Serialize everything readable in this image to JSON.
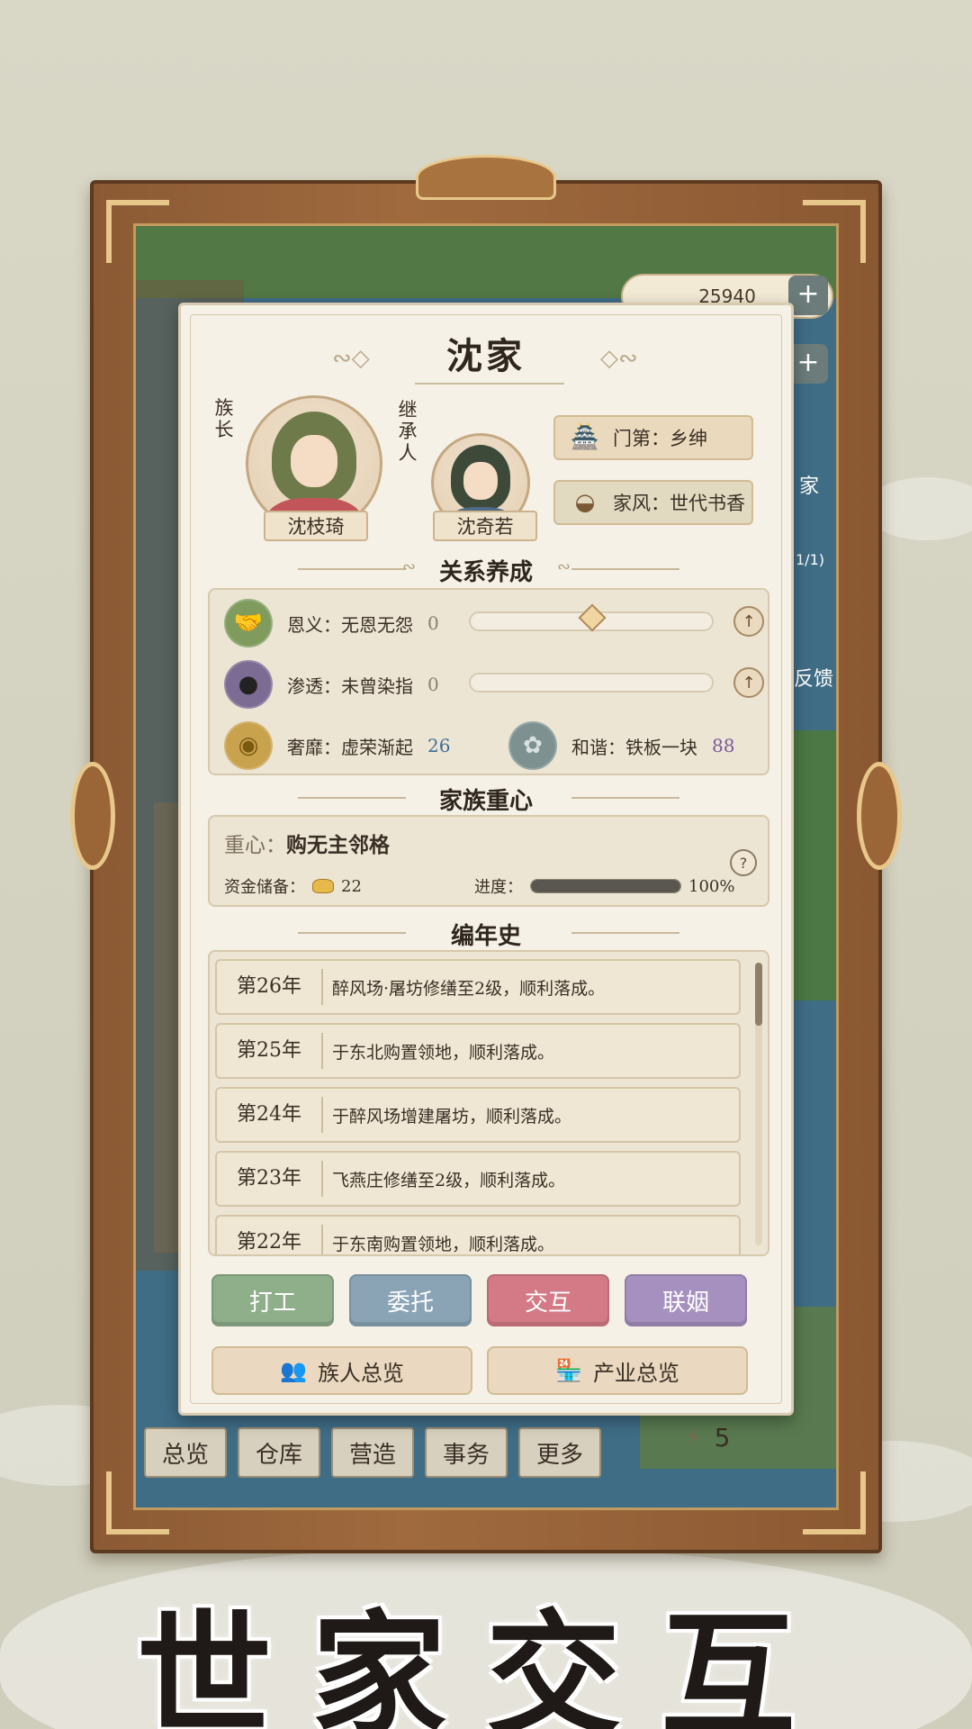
{
  "background_hud": {
    "coins": "25940",
    "plus": "+",
    "side_labels": [
      "家",
      "1/1)",
      "反馈"
    ],
    "bottom_tabs": [
      "总览",
      "仓库",
      "营造",
      "事务",
      "更多"
    ],
    "energy": "5"
  },
  "panel": {
    "clan_name": "沈家",
    "leader": {
      "role": "族长",
      "name": "沈枝琦"
    },
    "heir": {
      "role": "继承人",
      "name": "沈奇若"
    },
    "tags": [
      {
        "icon": "pavilion-icon",
        "text": "门第：乡绅"
      },
      {
        "icon": "fan-icon",
        "text": "家风：世代书香"
      }
    ],
    "relations": {
      "title": "关系养成",
      "rows": [
        {
          "icon": "handshake-icon",
          "label": "恩义：无恩无怨",
          "value": "0",
          "level": 0.5
        },
        {
          "icon": "masked-figure-icon",
          "label": "渗透：未曾染指",
          "value": "0",
          "level": 0
        }
      ],
      "luxury": {
        "icon": "gold-ingots-icon",
        "label": "奢靡：虚荣渐起",
        "value": "26"
      },
      "harmony": {
        "icon": "lotus-icon",
        "label": "和谐：铁板一块",
        "value": "88"
      }
    },
    "focus": {
      "title": "家族重心",
      "label": "重心：",
      "value": "购无主邻格",
      "funds_label": "资金储备：",
      "funds_value": "22",
      "progress_label": "进度：",
      "progress_value": "100%",
      "progress_fraction": 1.0,
      "help": "?"
    },
    "chronicle": {
      "title": "编年史",
      "entries": [
        {
          "year": "第26年",
          "text": "醉风场·屠坊修缮至2级，顺利落成。"
        },
        {
          "year": "第25年",
          "text": "于东北购置领地，顺利落成。"
        },
        {
          "year": "第24年",
          "text": "于醉风场增建屠坊，顺利落成。"
        },
        {
          "year": "第23年",
          "text": "飞燕庄修缮至2级，顺利落成。"
        },
        {
          "year": "第22年",
          "text": "于东南购置领地，顺利落成。"
        }
      ]
    },
    "actions": [
      {
        "label": "打工",
        "color": "#8fae8a"
      },
      {
        "label": "委托",
        "color": "#8aa4b6"
      },
      {
        "label": "交互",
        "color": "#d47a86"
      },
      {
        "label": "联姻",
        "color": "#a590bf"
      }
    ],
    "overviews": [
      {
        "icon": "people-icon",
        "label": "族人总览"
      },
      {
        "icon": "shop-icon",
        "label": "产业总览"
      }
    ]
  },
  "promo_title": "世家交互"
}
